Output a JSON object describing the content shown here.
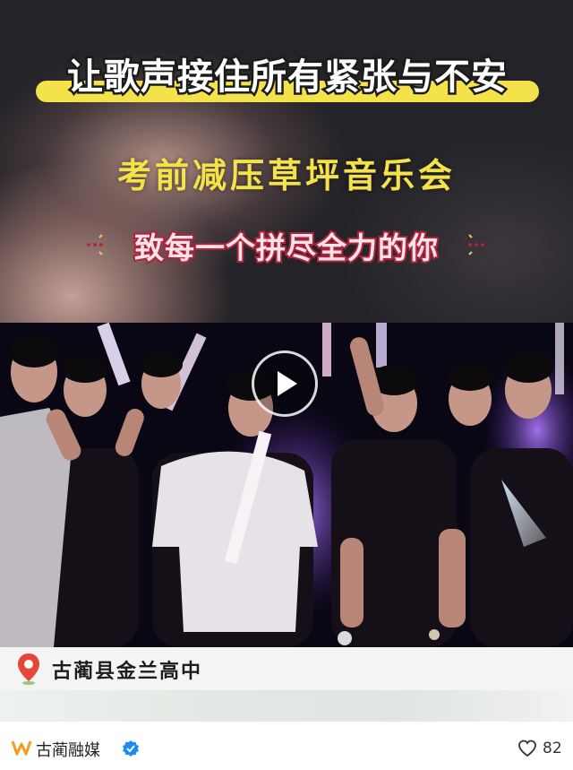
{
  "cover": {
    "headline": "让歌声接住所有紧张与不安",
    "subtitle": "考前减压草坪音乐会",
    "tagline": "致每一个拼尽全力的你"
  },
  "video": {
    "state": "paused",
    "play_icon": "play-icon"
  },
  "location": {
    "icon": "location-pin-icon",
    "name": "古蔺县金兰高中"
  },
  "footer": {
    "account_icon": "brand-logo-icon",
    "account_name": "古蔺融媒",
    "verified_icon": "verified-badge-icon",
    "like_icon": "heart-icon",
    "like_count": "82"
  },
  "colors": {
    "headline_bar": "#f3e24a",
    "subtitle": "#f4e24b",
    "tagline_stroke": "#b0233c",
    "verified": "#1d8cf2",
    "brand_logo": "#f0a02a"
  }
}
